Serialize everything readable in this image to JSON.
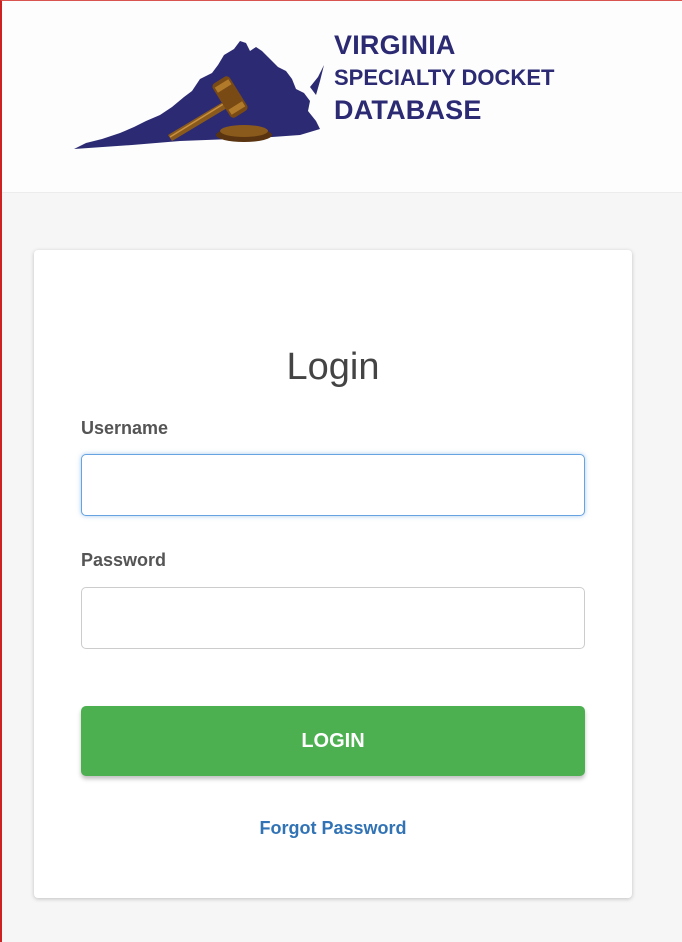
{
  "header": {
    "logo": {
      "line1": "VIRGINIA",
      "line2": "SPECIALTY DOCKET",
      "line3": "DATABASE",
      "icon": "virginia-map-gavel-icon",
      "color": "#2b2a73"
    }
  },
  "login": {
    "title": "Login",
    "username_label": "Username",
    "username_value": "",
    "password_label": "Password",
    "password_value": "",
    "submit_label": "LOGIN",
    "forgot_label": "Forgot Password"
  },
  "colors": {
    "brand": "#2b2a73",
    "button": "#4caf50",
    "link": "#3173b5",
    "focus": "#66a3e0"
  }
}
